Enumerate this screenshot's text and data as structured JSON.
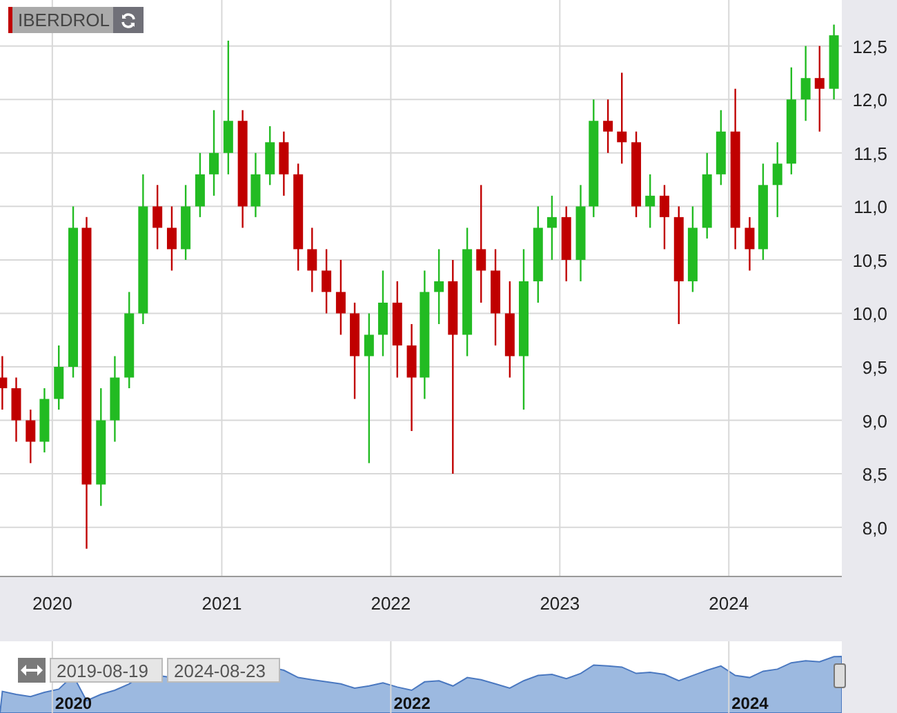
{
  "legend": {
    "color": "#c00000"
  },
  "chart_data": {
    "type": "candlestick",
    "title": "IBERDROL",
    "grid": true,
    "x": [
      "2019-09-15",
      "2019-10-15",
      "2019-11-15",
      "2019-12-15",
      "2020-01-15",
      "2020-02-15",
      "2020-03-15",
      "2020-04-15",
      "2020-05-15",
      "2020-06-15",
      "2020-07-15",
      "2020-08-15",
      "2020-09-15",
      "2020-10-15",
      "2020-11-15",
      "2020-12-15",
      "2021-01-15",
      "2021-02-15",
      "2021-03-15",
      "2021-04-15",
      "2021-05-15",
      "2021-06-15",
      "2021-07-15",
      "2021-08-15",
      "2021-09-15",
      "2021-10-15",
      "2021-11-15",
      "2021-12-15",
      "2022-01-15",
      "2022-02-15",
      "2022-03-15",
      "2022-04-15",
      "2022-05-15",
      "2022-06-15",
      "2022-07-15",
      "2022-08-15",
      "2022-09-15",
      "2022-10-15",
      "2022-11-15",
      "2022-12-15",
      "2023-01-15",
      "2023-02-15",
      "2023-03-15",
      "2023-04-15",
      "2023-05-15",
      "2023-06-15",
      "2023-07-15",
      "2023-08-15",
      "2023-09-15",
      "2023-10-15",
      "2023-11-15",
      "2023-12-15",
      "2024-01-15",
      "2024-02-15",
      "2024-03-15",
      "2024-04-15",
      "2024-05-15",
      "2024-06-15",
      "2024-07-15",
      "2024-08-15"
    ],
    "ohlc": [
      [
        9.4,
        9.6,
        9.1,
        9.3
      ],
      [
        9.3,
        9.4,
        8.8,
        9.0
      ],
      [
        9.0,
        9.1,
        8.6,
        8.8
      ],
      [
        8.8,
        9.3,
        8.7,
        9.2
      ],
      [
        9.2,
        9.7,
        9.1,
        9.5
      ],
      [
        9.5,
        11.0,
        9.4,
        10.8
      ],
      [
        10.8,
        10.9,
        7.8,
        8.4
      ],
      [
        8.4,
        9.3,
        8.2,
        9.0
      ],
      [
        9.0,
        9.6,
        8.8,
        9.4
      ],
      [
        9.4,
        10.2,
        9.3,
        10.0
      ],
      [
        10.0,
        11.3,
        9.9,
        11.0
      ],
      [
        11.0,
        11.2,
        10.6,
        10.8
      ],
      [
        10.8,
        11.0,
        10.4,
        10.6
      ],
      [
        10.6,
        11.2,
        10.5,
        11.0
      ],
      [
        11.0,
        11.5,
        10.9,
        11.3
      ],
      [
        11.3,
        11.9,
        11.1,
        11.5
      ],
      [
        11.5,
        12.55,
        11.3,
        11.8
      ],
      [
        11.8,
        11.9,
        10.8,
        11.0
      ],
      [
        11.0,
        11.5,
        10.9,
        11.3
      ],
      [
        11.3,
        11.75,
        11.2,
        11.6
      ],
      [
        11.6,
        11.7,
        11.1,
        11.3
      ],
      [
        11.3,
        11.4,
        10.4,
        10.6
      ],
      [
        10.6,
        10.8,
        10.2,
        10.4
      ],
      [
        10.4,
        10.6,
        10.0,
        10.2
      ],
      [
        10.2,
        10.5,
        9.8,
        10.0
      ],
      [
        10.0,
        10.1,
        9.2,
        9.6
      ],
      [
        9.6,
        10.0,
        8.6,
        9.8
      ],
      [
        9.8,
        10.4,
        9.6,
        10.1
      ],
      [
        10.1,
        10.3,
        9.4,
        9.7
      ],
      [
        9.7,
        9.9,
        8.9,
        9.4
      ],
      [
        9.4,
        10.4,
        9.2,
        10.2
      ],
      [
        10.2,
        10.6,
        9.9,
        10.3
      ],
      [
        10.3,
        10.5,
        8.5,
        9.8
      ],
      [
        9.8,
        10.8,
        9.6,
        10.6
      ],
      [
        10.6,
        11.2,
        10.1,
        10.4
      ],
      [
        10.4,
        10.6,
        9.7,
        10.0
      ],
      [
        10.0,
        10.3,
        9.4,
        9.6
      ],
      [
        9.6,
        10.6,
        9.1,
        10.3
      ],
      [
        10.3,
        11.0,
        10.1,
        10.8
      ],
      [
        10.8,
        11.1,
        10.5,
        10.9
      ],
      [
        10.9,
        11.0,
        10.3,
        10.5
      ],
      [
        10.5,
        11.2,
        10.3,
        11.0
      ],
      [
        11.0,
        12.0,
        10.9,
        11.8
      ],
      [
        11.8,
        12.0,
        11.5,
        11.7
      ],
      [
        11.7,
        12.25,
        11.4,
        11.6
      ],
      [
        11.6,
        11.7,
        10.9,
        11.0
      ],
      [
        11.0,
        11.3,
        10.8,
        11.1
      ],
      [
        11.1,
        11.2,
        10.6,
        10.9
      ],
      [
        10.9,
        11.0,
        9.9,
        10.3
      ],
      [
        10.3,
        11.0,
        10.2,
        10.8
      ],
      [
        10.8,
        11.5,
        10.7,
        11.3
      ],
      [
        11.3,
        11.9,
        11.2,
        11.7
      ],
      [
        11.7,
        12.1,
        10.6,
        10.8
      ],
      [
        10.8,
        10.9,
        10.4,
        10.6
      ],
      [
        10.6,
        11.4,
        10.5,
        11.2
      ],
      [
        11.2,
        11.6,
        10.9,
        11.4
      ],
      [
        11.4,
        12.3,
        11.3,
        12.0
      ],
      [
        12.0,
        12.5,
        11.8,
        12.2
      ],
      [
        12.2,
        12.5,
        11.7,
        12.1
      ],
      [
        12.1,
        12.7,
        12.0,
        12.6
      ]
    ],
    "xlim": [
      "2019-09-10",
      "2024-09-01"
    ],
    "ylim": [
      7.54,
      12.93
    ],
    "yticks": [
      {
        "value": 8,
        "label": "8,0"
      },
      {
        "value": 8.5,
        "label": "8,5"
      },
      {
        "value": 9,
        "label": "9,0"
      },
      {
        "value": 9.5,
        "label": "9,5"
      },
      {
        "value": 10,
        "label": "10,0"
      },
      {
        "value": 10.5,
        "label": "10,5"
      },
      {
        "value": 11,
        "label": "11,0"
      },
      {
        "value": 11.5,
        "label": "11,5"
      },
      {
        "value": 12,
        "label": "12,0"
      },
      {
        "value": 12.5,
        "label": "12,5"
      }
    ],
    "xticks": [
      {
        "value": "2020-01-01",
        "label": "2020"
      },
      {
        "value": "2021-01-01",
        "label": "2021"
      },
      {
        "value": "2022-01-01",
        "label": "2022"
      },
      {
        "value": "2023-01-01",
        "label": "2023"
      },
      {
        "value": "2024-01-01",
        "label": "2024"
      }
    ]
  },
  "navigator": {
    "from": "2019-08-19",
    "to": "2024-08-23",
    "year_labels": [
      "2020",
      "2022",
      "2024"
    ]
  }
}
